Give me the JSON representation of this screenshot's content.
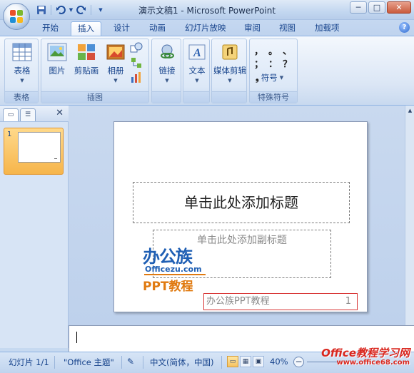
{
  "window": {
    "title": "演示文稿1 - Microsoft PowerPoint",
    "controls": [
      "─",
      "□",
      "✕"
    ]
  },
  "quick_access": {
    "save_icon": "save-icon",
    "undo_icon": "undo-icon",
    "redo_icon": "redo-icon"
  },
  "tabs": [
    {
      "label": "开始",
      "active": false
    },
    {
      "label": "插入",
      "active": true
    },
    {
      "label": "设计",
      "active": false
    },
    {
      "label": "动画",
      "active": false
    },
    {
      "label": "幻灯片放映",
      "active": false
    },
    {
      "label": "审阅",
      "active": false
    },
    {
      "label": "视图",
      "active": false
    },
    {
      "label": "加载项",
      "active": false
    }
  ],
  "ribbon": {
    "groups": [
      {
        "label": "表格",
        "buttons": [
          "表格"
        ]
      },
      {
        "label": "插图",
        "buttons": [
          "图片",
          "剪贴画",
          "相册"
        ]
      },
      {
        "label": "",
        "buttons": [
          "链接"
        ]
      },
      {
        "label": "",
        "buttons": [
          "文本"
        ]
      },
      {
        "label": "",
        "buttons": [
          "媒体剪辑"
        ]
      },
      {
        "label": "特殊符号",
        "buttons": [
          "符号"
        ]
      }
    ],
    "symbols": [
      "，",
      "。",
      "、",
      "；",
      "：",
      "？"
    ]
  },
  "slide_pane": {
    "thumb_number": "1"
  },
  "slide": {
    "title_placeholder": "单击此处添加标题",
    "subtitle_placeholder": "单击此处添加副标题",
    "footer_text": "办公族PPT教程",
    "slide_number": "1"
  },
  "watermark": {
    "line1": "办公族",
    "line2": "Officezu.com",
    "line3": "PPT教程"
  },
  "status": {
    "slide_info": "幻灯片 1/1",
    "theme": "\"Office 主题\"",
    "language": "中文(简体，中国)",
    "zoom": "40%"
  },
  "brand": {
    "line1": "Office教程学习网",
    "line2": "www.office68.com"
  },
  "colors": {
    "accent": "#15428b",
    "ribbon_bg": "#dbe6f5",
    "selected_thumb": "#f6b54b",
    "footer_border": "#d83434"
  }
}
